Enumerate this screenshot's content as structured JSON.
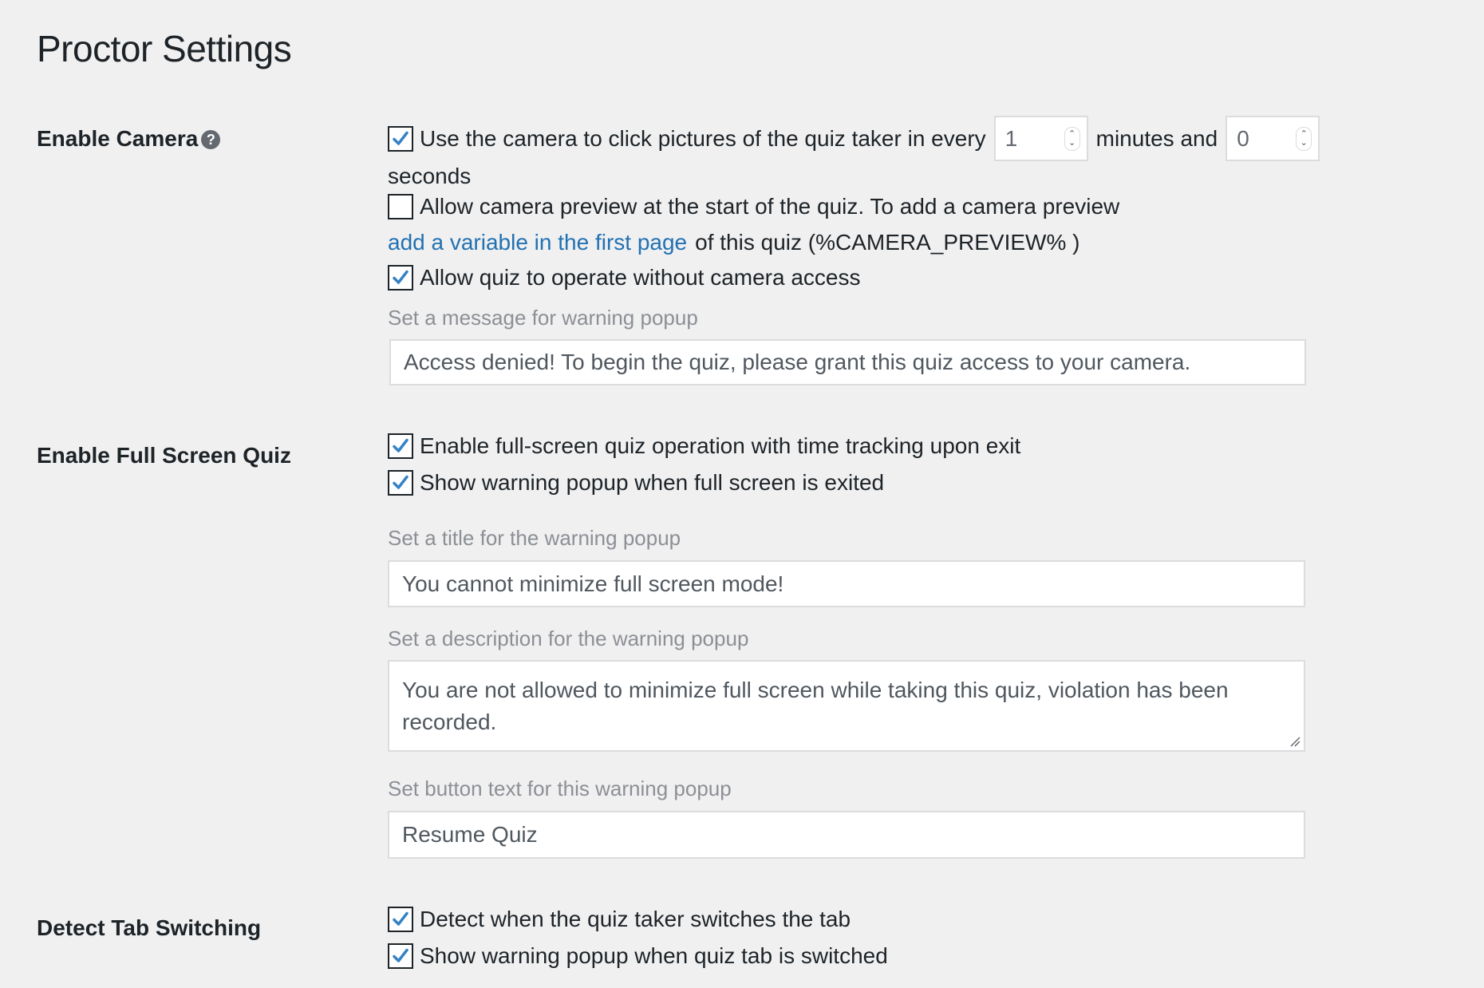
{
  "page": {
    "title": "Proctor Settings"
  },
  "colors": {
    "accent": "#2271b1",
    "checkmark": "#3582c4",
    "background": "#f0f0f1"
  },
  "camera": {
    "label": "Enable Camera",
    "help_icon": "question-circle-icon",
    "capture": {
      "checked": true,
      "text_before": "Use the camera to click pictures of the quiz taker in every",
      "minutes_value": "1",
      "text_middle": "minutes and",
      "seconds_value": "0",
      "text_after": "seconds"
    },
    "preview": {
      "checked": false,
      "text": "Allow camera preview at the start of the quiz. To add a camera preview",
      "link_text": "add a variable in the first page",
      "text_after_link": "of this quiz (%CAMERA_PREVIEW% )"
    },
    "without_access": {
      "checked": true,
      "text": "Allow quiz to operate without camera access"
    },
    "warning_message": {
      "label": "Set a message for warning popup",
      "value": "Access denied! To begin the quiz, please grant this quiz access to your camera."
    }
  },
  "fullscreen": {
    "label": "Enable Full Screen Quiz",
    "enable": {
      "checked": true,
      "text": "Enable full-screen quiz operation with time tracking upon exit"
    },
    "show_warning": {
      "checked": true,
      "text": "Show warning popup when full screen is exited"
    },
    "title_field": {
      "label": "Set a title for the warning popup",
      "value": "You cannot minimize full screen mode!"
    },
    "description_field": {
      "label": "Set a description for the warning popup",
      "value": "You are not allowed to minimize full screen while taking this quiz, violation has been recorded."
    },
    "button_field": {
      "label": "Set button text for this warning popup",
      "value": "Resume Quiz"
    }
  },
  "tab_switching": {
    "label": "Detect Tab Switching",
    "detect": {
      "checked": true,
      "text": "Detect when the quiz taker switches the tab"
    },
    "show_warning": {
      "checked": true,
      "text": "Show warning popup when quiz tab is switched"
    }
  }
}
